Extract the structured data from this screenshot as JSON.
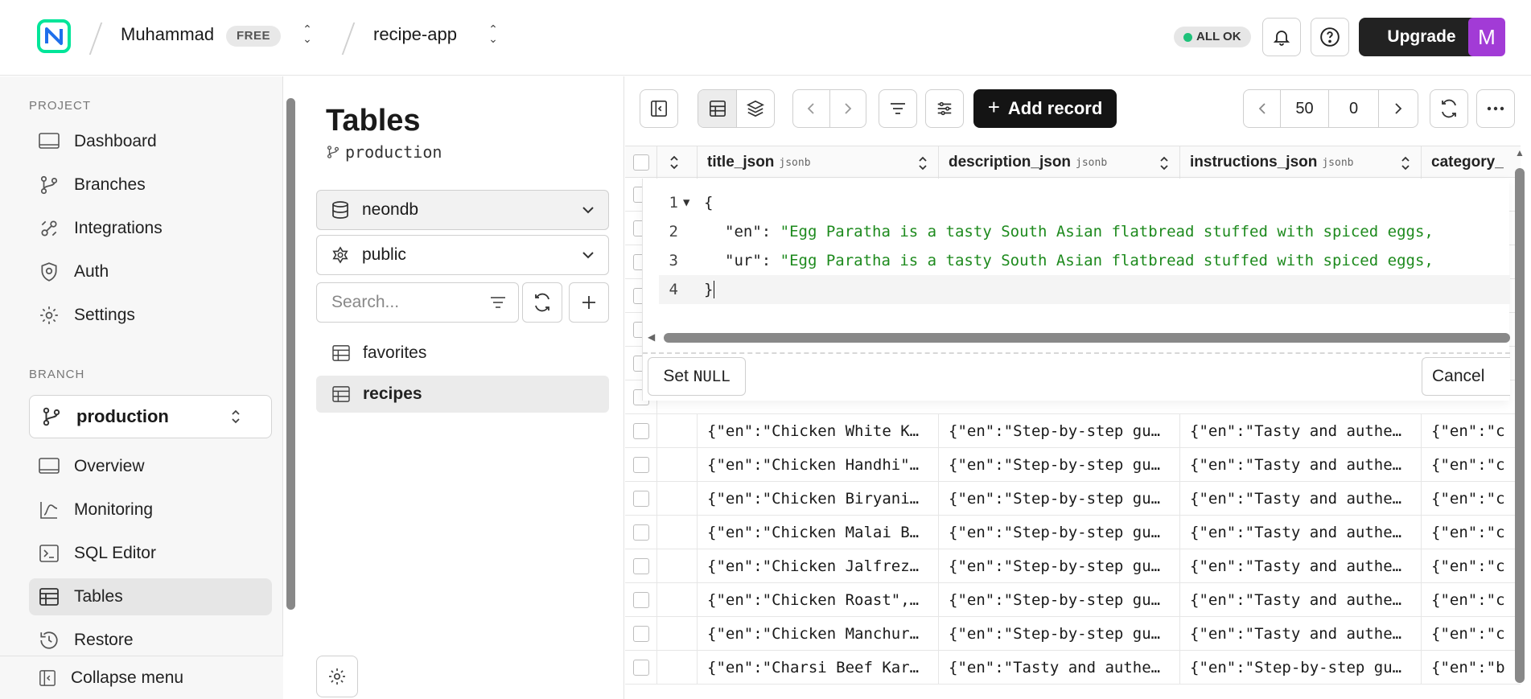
{
  "header": {
    "user": "Muhammad",
    "plan_badge": "FREE",
    "project": "recipe-app",
    "status": "ALL OK",
    "upgrade_label": "Upgrade",
    "avatar_initial": "M",
    "brand_color": "#00e599",
    "avatar_color": "#a23bd6"
  },
  "sidebar": {
    "project_title": "PROJECT",
    "project_items": [
      {
        "label": "Dashboard",
        "icon": "dashboard-icon"
      },
      {
        "label": "Branches",
        "icon": "branch-icon"
      },
      {
        "label": "Integrations",
        "icon": "integrations-icon"
      },
      {
        "label": "Auth",
        "icon": "shield-icon"
      },
      {
        "label": "Settings",
        "icon": "gear-icon"
      }
    ],
    "branch_title": "BRANCH",
    "branch_selected": "production",
    "branch_items": [
      {
        "label": "Overview",
        "icon": "overview-icon"
      },
      {
        "label": "Monitoring",
        "icon": "monitoring-icon"
      },
      {
        "label": "SQL Editor",
        "icon": "terminal-icon"
      },
      {
        "label": "Tables",
        "icon": "table-icon",
        "active": true
      },
      {
        "label": "Restore",
        "icon": "restore-icon"
      }
    ],
    "collapse_label": "Collapse menu"
  },
  "tables_panel": {
    "title": "Tables",
    "branch": "production",
    "database": "neondb",
    "schema": "public",
    "search_placeholder": "Search...",
    "tables": [
      {
        "name": "favorites",
        "active": false
      },
      {
        "name": "recipes",
        "active": true
      }
    ]
  },
  "toolbar": {
    "add_record_label": "Add record",
    "page_size": "50",
    "offset": "0"
  },
  "grid": {
    "columns": [
      {
        "name": "title_json",
        "type": "jsonb"
      },
      {
        "name": "description_json",
        "type": "jsonb"
      },
      {
        "name": "instructions_json",
        "type": "jsonb"
      },
      {
        "name": "category_",
        "type": ""
      }
    ],
    "rows": [
      [
        "{\"en\":\"Chicken White K…",
        "{\"en\":\"Step-by-step gu…",
        "{\"en\":\"Tasty and authe…",
        "{\"en\":\"c"
      ],
      [
        "{\"en\":\"Chicken Handhi\"…",
        "{\"en\":\"Step-by-step gu…",
        "{\"en\":\"Tasty and authe…",
        "{\"en\":\"c"
      ],
      [
        "{\"en\":\"Chicken Biryani…",
        "{\"en\":\"Step-by-step gu…",
        "{\"en\":\"Tasty and authe…",
        "{\"en\":\"c"
      ],
      [
        "{\"en\":\"Chicken Malai B…",
        "{\"en\":\"Step-by-step gu…",
        "{\"en\":\"Tasty and authe…",
        "{\"en\":\"c"
      ],
      [
        "{\"en\":\"Chicken Jalfrez…",
        "{\"en\":\"Step-by-step gu…",
        "{\"en\":\"Tasty and authe…",
        "{\"en\":\"c"
      ],
      [
        "{\"en\":\"Chicken Roast\",…",
        "{\"en\":\"Step-by-step gu…",
        "{\"en\":\"Tasty and authe…",
        "{\"en\":\"c"
      ],
      [
        "{\"en\":\"Chicken Manchur…",
        "{\"en\":\"Step-by-step gu…",
        "{\"en\":\"Tasty and authe…",
        "{\"en\":\"c"
      ],
      [
        "{\"en\":\"Charsi Beef Kar…",
        "{\"en\":\"Tasty and authe…",
        "{\"en\":\"Step-by-step gu…",
        "{\"en\":\"b"
      ]
    ]
  },
  "editor": {
    "lines": [
      {
        "num": "1",
        "fold": "▼",
        "open": "{"
      },
      {
        "num": "2",
        "key": "\"en\"",
        "value": "\"Egg Paratha is a tasty South Asian flatbread stuffed with spiced eggs,"
      },
      {
        "num": "3",
        "key": "\"ur\"",
        "value": "\"Egg Paratha is a tasty South Asian flatbread stuffed with spiced eggs,"
      },
      {
        "num": "4",
        "close": "}"
      }
    ],
    "set_label": "Set",
    "null_label": "NULL",
    "cancel_label": "Cancel"
  }
}
